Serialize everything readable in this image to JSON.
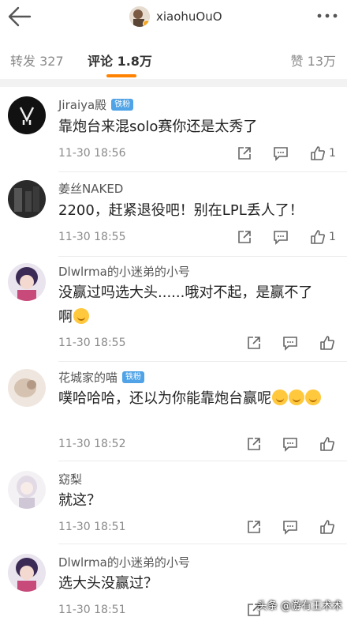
{
  "header": {
    "title": "xiaohuOuO"
  },
  "tabs": {
    "forward": "转发 327",
    "comment": "评论 1.8万",
    "like": "赞 13万"
  },
  "comments": [
    {
      "user": "Jiraiya殿",
      "tag": "铁粉",
      "text": "靠炮台来混solo赛你还是太秀了",
      "time": "11-30 18:56",
      "likes": "1"
    },
    {
      "user": "姜丝NAKED",
      "tag": "",
      "text": "2200，赶紧退役吧！别在LPL丢人了！",
      "time": "11-30 18:55",
      "likes": "1"
    },
    {
      "user": "Dlwlrma的小迷弟的小号",
      "tag": "",
      "text": "没赢过吗选大头......哦对不起，是赢不了啊",
      "time": "11-30 18:55",
      "likes": ""
    },
    {
      "user": "花城家的喵",
      "tag": "铁粉",
      "text": "噗哈哈哈，还以为你能靠炮台赢呢",
      "time": "11-30 18:52",
      "likes": ""
    },
    {
      "user": "窈梨",
      "tag": "",
      "text": "就这？",
      "time": "11-30 18:51",
      "likes": ""
    },
    {
      "user": "Dlwlrma的小迷弟的小号",
      "tag": "",
      "text": "选大头没赢过？",
      "time": "11-30 18:51",
      "likes": ""
    }
  ],
  "watermark": "头条 @游有王术术"
}
